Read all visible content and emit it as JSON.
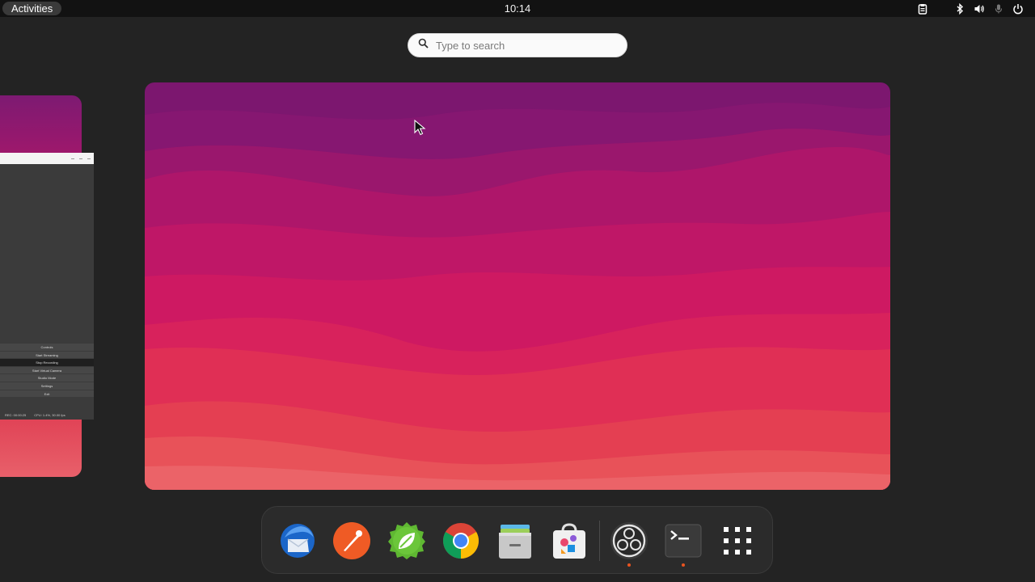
{
  "topbar": {
    "activities_label": "Activities",
    "clock": "10:14",
    "tray_icons": [
      "clipboard-icon",
      "bluetooth-icon",
      "volume-icon",
      "microphone-icon",
      "power-icon"
    ]
  },
  "search": {
    "placeholder": "Type to search",
    "value": ""
  },
  "obs_window": {
    "menu_items": [
      "Controls",
      "Start Streaming",
      "Stop Recording",
      "Start Virtual Camera",
      "Studio Mode",
      "Settings",
      "Exit"
    ],
    "status_rec": "REC: 00:00:25",
    "status_cpu": "CPU: 1.4%, 30.00 fps"
  },
  "dash": {
    "apps": [
      {
        "name": "thunderbird-icon",
        "running": false
      },
      {
        "name": "postman-icon",
        "running": false
      },
      {
        "name": "spring-tools-icon",
        "running": false
      },
      {
        "name": "chrome-icon",
        "running": false
      },
      {
        "name": "files-icon",
        "running": false
      },
      {
        "name": "software-store-icon",
        "running": false
      },
      {
        "name": "obs-studio-icon",
        "running": true
      },
      {
        "name": "terminal-icon",
        "running": true
      },
      {
        "name": "show-applications-icon",
        "running": false
      }
    ],
    "accent_color": "#e95420"
  }
}
